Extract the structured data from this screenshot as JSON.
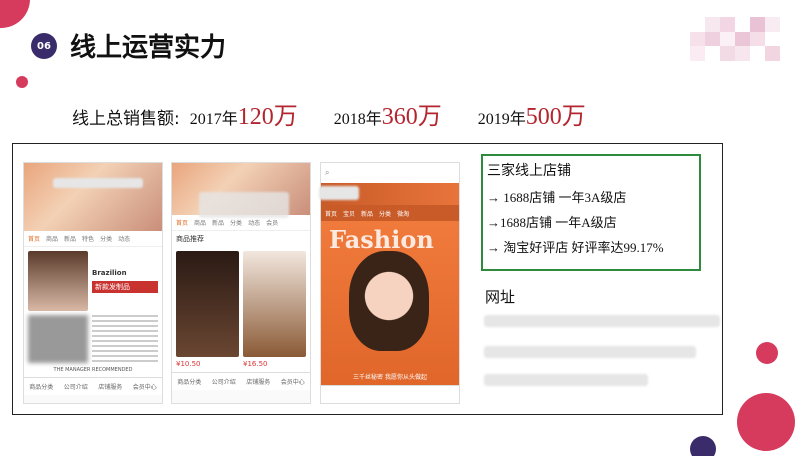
{
  "badge": "06",
  "title": "线上运营实力",
  "sales": {
    "label": "线上总销售额:",
    "items": [
      {
        "year": "2017年",
        "amount": "120万"
      },
      {
        "year": "2018年",
        "amount": "360万"
      },
      {
        "year": "2019年",
        "amount": "500万"
      }
    ]
  },
  "stores": {
    "heading": "三家线上店铺",
    "items": [
      "→ 1688店铺 一年3A级店",
      "→1688店铺 一年A级店",
      "→ 淘宝好评店 好评率达99.17%"
    ]
  },
  "url_label": "网址",
  "phone1": {
    "tabs": [
      "首页",
      "商品",
      "新品",
      "特色",
      "分类",
      "动态"
    ],
    "ad_line": "新款发制品",
    "banner_text": "THE MANAGER RECOMMENDED",
    "bottom": [
      "商品分类",
      "公司介绍",
      "店铺服务",
      "会员中心"
    ]
  },
  "phone2": {
    "tabs": [
      "首页",
      "商品",
      "新品",
      "分类",
      "动态",
      "会员"
    ],
    "section": "商品推荐",
    "prices": [
      "¥10.50",
      "¥16.50"
    ],
    "bottom": [
      "商品分类",
      "公司介绍",
      "店铺服务",
      "会员中心"
    ]
  },
  "phone3": {
    "tabs": [
      "首页",
      "宝贝",
      "新品",
      "分类",
      "微淘"
    ],
    "hero_word": "Fashion",
    "bottom_text": "三千丝秘密 我愿你从头做起"
  },
  "colors": {
    "accent": "#b3262f",
    "box": "#2e8b3d",
    "badge": "#3a2c6a"
  }
}
